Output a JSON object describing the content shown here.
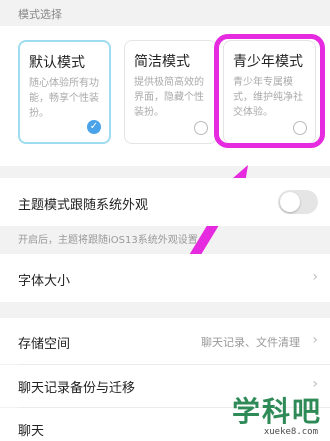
{
  "section": {
    "title": "模式选择"
  },
  "modes": [
    {
      "title": "默认模式",
      "desc": "随心体验所有功能，畅享个性装扮。",
      "selected": true
    },
    {
      "title": "简洁模式",
      "desc": "提供极简高效的界面，隐藏个性装扮。",
      "selected": false
    },
    {
      "title": "青少年模式",
      "desc": "青少年专属模式，维护纯净社交体验。",
      "selected": false
    }
  ],
  "follow_system": {
    "label": "主题模式跟随系统外观",
    "enabled": false,
    "hint": "开启后，主题将跟随iOS13系统外观设置"
  },
  "settings": {
    "font_size": "字体大小",
    "storage": {
      "label": "存储空间",
      "value": "聊天记录、文件清理"
    },
    "backup": "聊天记录备份与迁移",
    "chat": "聊天"
  },
  "watermark": {
    "main": "学科吧",
    "sub": "xueke8.com"
  },
  "colors": {
    "highlight": "#e52adf",
    "selected_border": "#9edcf0",
    "check": "#4aa3e8"
  }
}
